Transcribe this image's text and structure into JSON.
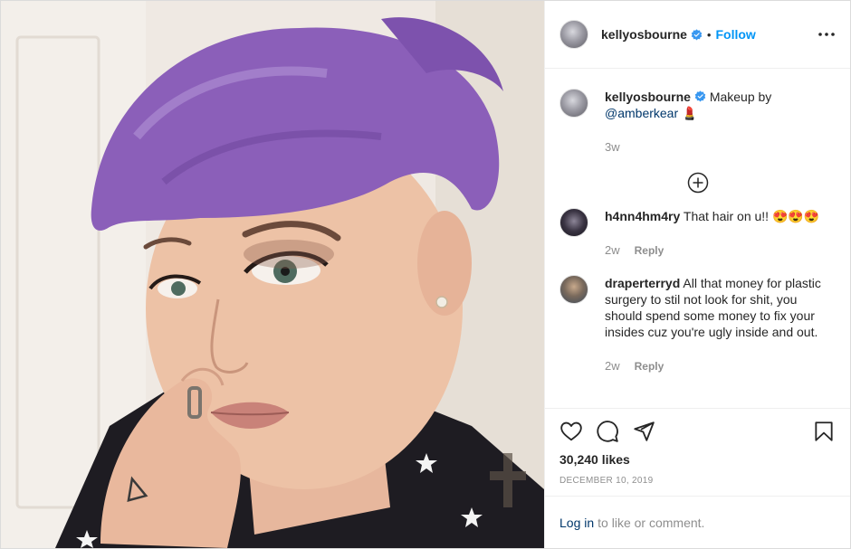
{
  "header": {
    "username": "kellyosbourne",
    "separator": "•",
    "follow_label": "Follow"
  },
  "caption": {
    "username": "kellyosbourne",
    "text": "Makeup by",
    "mention": "@amberkear",
    "emoji": "💄",
    "time": "3w"
  },
  "comments": [
    {
      "username": "h4nn4hm4ry",
      "text": "That hair on u!! 😍😍😍",
      "time": "2w",
      "reply_label": "Reply"
    },
    {
      "username": "draperterryd",
      "text": "All that money for plastic surgery to stil not look for shit, you should spend some money to fix your insides cuz you're ugly inside and out.",
      "time": "2w",
      "reply_label": "Reply"
    }
  ],
  "post": {
    "likes": "30,240 likes",
    "date": "DECEMBER 10, 2019"
  },
  "login": {
    "link_label": "Log in",
    "text": "to like or comment."
  },
  "colors": {
    "accent": "#0095f6",
    "link": "#00376b",
    "muted": "#8e8e8e",
    "hair": "#8a5fb8"
  },
  "icons": [
    "verified-badge-icon",
    "more-options-icon",
    "load-more-comments-icon",
    "heart-icon",
    "comment-icon",
    "share-icon",
    "bookmark-icon"
  ]
}
